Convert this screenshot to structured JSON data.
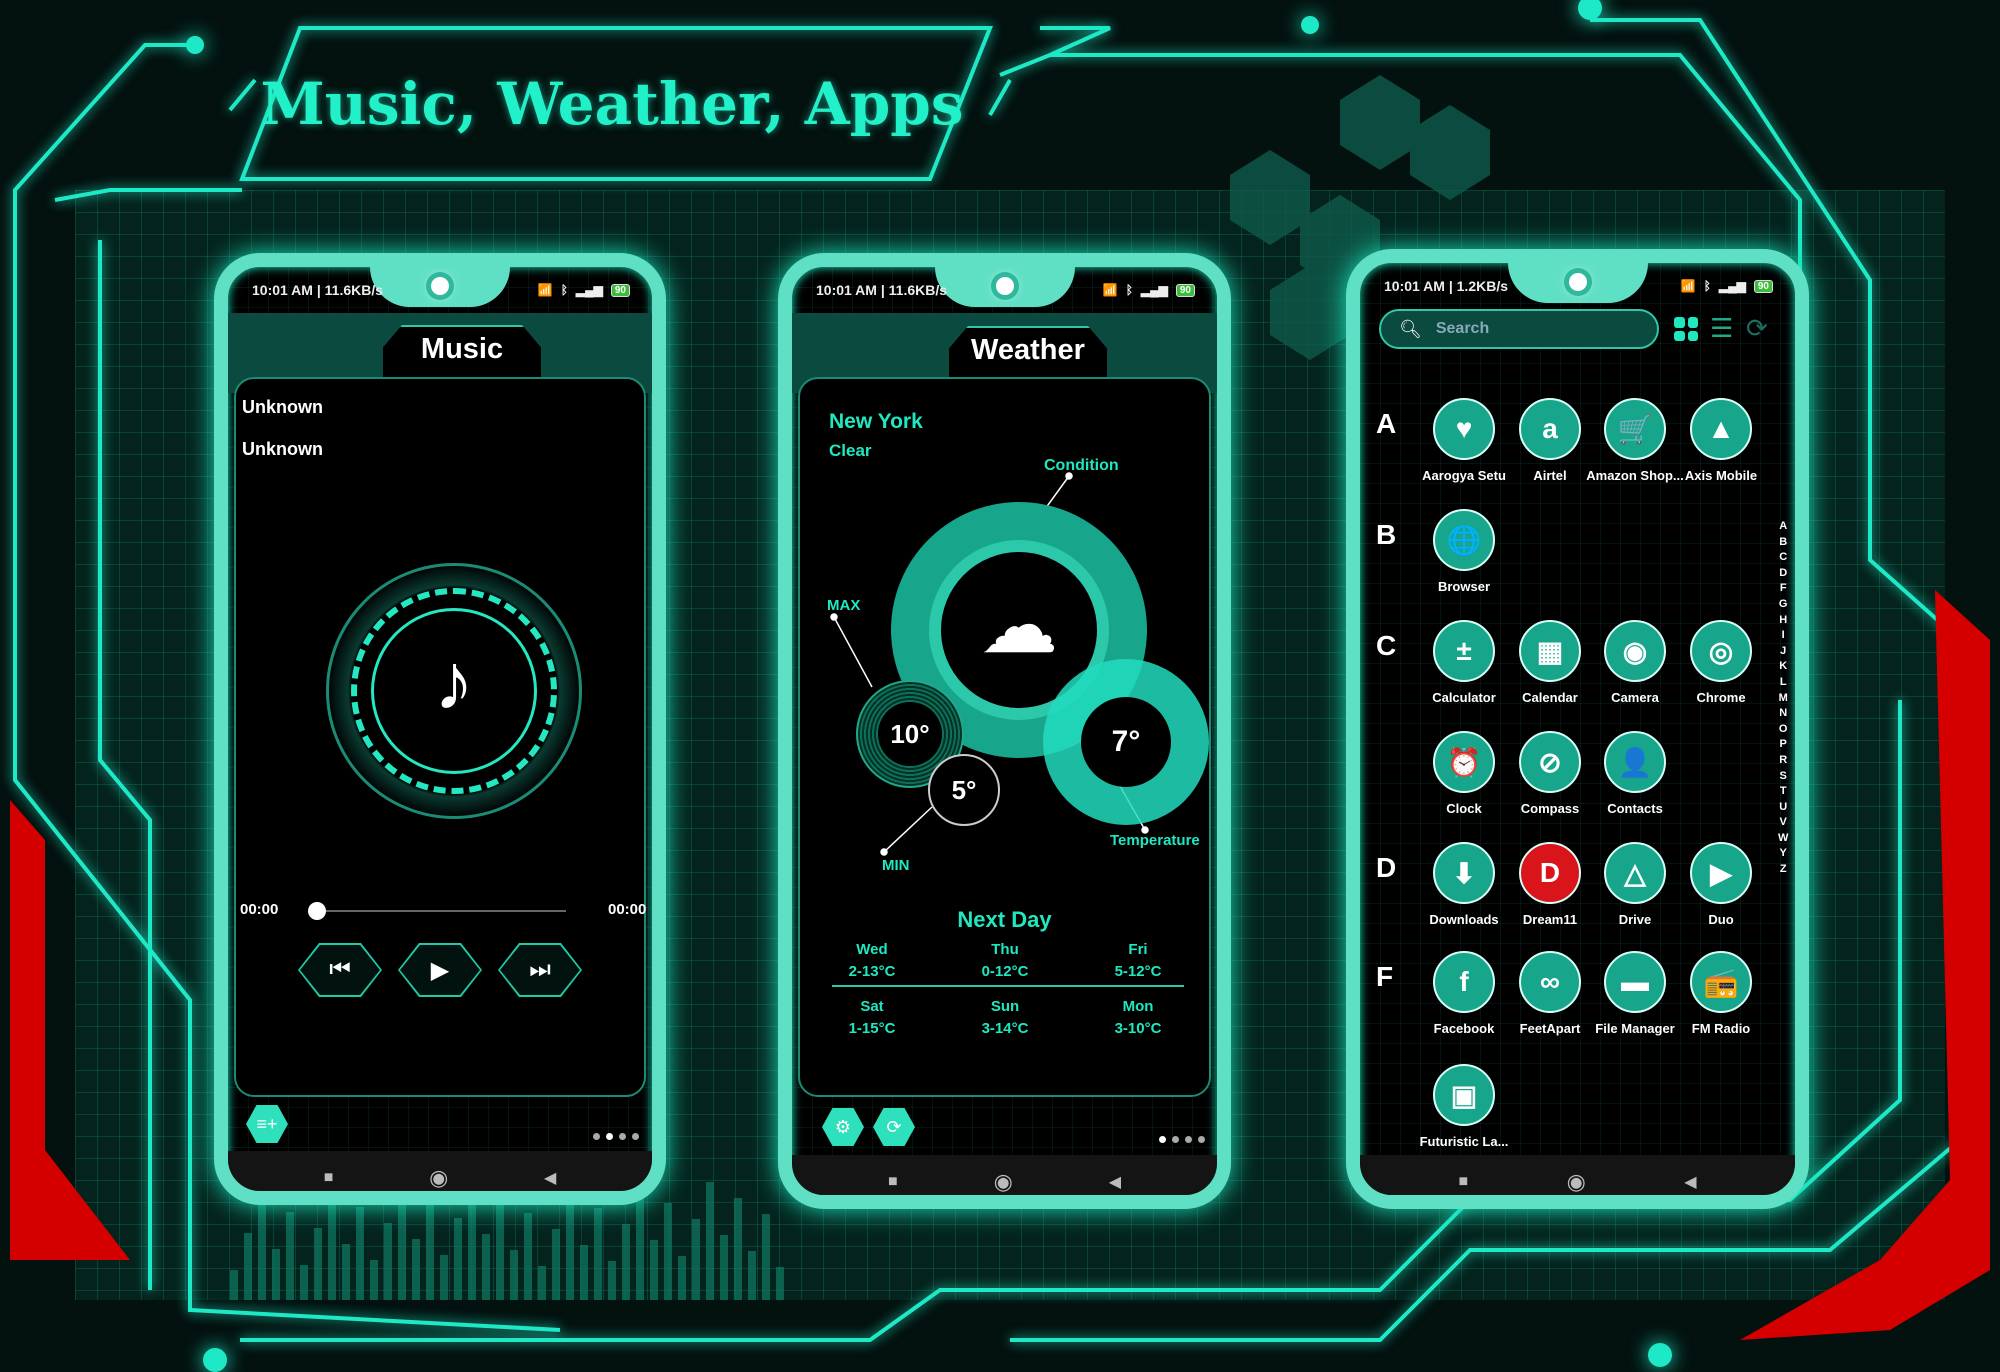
{
  "banner": {
    "title": "Music, Weather, Apps"
  },
  "colors": {
    "accent": "#1de9c6",
    "background": "#03110f",
    "alert": "#d40000",
    "icon_fill": "#17a58b"
  },
  "music_phone": {
    "status": {
      "time": "10:01 AM | 11.6KB/s",
      "battery": "90"
    },
    "header": "Music",
    "track_title": "Unknown",
    "track_artist": "Unknown",
    "elapsed": "00:00",
    "duration": "00:00",
    "progress": 0,
    "controls": {
      "prev": "⏮",
      "play": "▶",
      "next": "⏭"
    },
    "playlist_icon": "playlist-add-icon",
    "page_dots": 4,
    "page_active": 1
  },
  "weather_phone": {
    "status": {
      "time": "10:01 AM | 11.6KB/s",
      "battery": "90"
    },
    "header": "Weather",
    "city": "New York",
    "condition": "Clear",
    "labels": {
      "condition": "Condition",
      "max": "MAX",
      "min": "MIN",
      "temperature": "Temperature"
    },
    "max_temp": "10°",
    "min_temp": "5°",
    "current_temp": "7°",
    "next_day_title": "Next Day",
    "forecast": [
      {
        "day": "Wed",
        "range": "2-13°C"
      },
      {
        "day": "Thu",
        "range": "0-12°C"
      },
      {
        "day": "Fri",
        "range": "5-12°C"
      },
      {
        "day": "Sat",
        "range": "1-15°C"
      },
      {
        "day": "Sun",
        "range": "3-14°C"
      },
      {
        "day": "Mon",
        "range": "3-10°C"
      }
    ],
    "buttons": {
      "settings": "⚙",
      "refresh": "⟳"
    },
    "page_dots": 4,
    "page_active": 0
  },
  "apps_phone": {
    "status": {
      "time": "10:01 AM | 1.2KB/s",
      "battery": "90"
    },
    "search_placeholder": "Search",
    "view_icons": [
      "grid-view-icon",
      "list-view-icon",
      "refresh-icon"
    ],
    "sections": [
      {
        "letter": "A",
        "rows": [
          [
            {
              "name": "Aarogya Setu",
              "glyph": "♥"
            },
            {
              "name": "Airtel",
              "glyph": "a"
            },
            {
              "name": "Amazon Shop...",
              "glyph": "🛒"
            },
            {
              "name": "Axis Mobile",
              "glyph": "▲"
            }
          ]
        ]
      },
      {
        "letter": "B",
        "rows": [
          [
            {
              "name": "Browser",
              "glyph": "🌐"
            }
          ]
        ]
      },
      {
        "letter": "C",
        "rows": [
          [
            {
              "name": "Calculator",
              "glyph": "±"
            },
            {
              "name": "Calendar",
              "glyph": "▦"
            },
            {
              "name": "Camera",
              "glyph": "◉"
            },
            {
              "name": "Chrome",
              "glyph": "◎"
            }
          ],
          [
            {
              "name": "Clock",
              "glyph": "⏰"
            },
            {
              "name": "Compass",
              "glyph": "⊘"
            },
            {
              "name": "Contacts",
              "glyph": "👤"
            }
          ]
        ]
      },
      {
        "letter": "D",
        "rows": [
          [
            {
              "name": "Downloads",
              "glyph": "⬇"
            },
            {
              "name": "Dream11",
              "glyph": "D"
            },
            {
              "name": "Drive",
              "glyph": "△"
            },
            {
              "name": "Duo",
              "glyph": "▶"
            }
          ]
        ]
      },
      {
        "letter": "F",
        "rows": [
          [
            {
              "name": "Facebook",
              "glyph": "f"
            },
            {
              "name": "FeetApart",
              "glyph": "∞"
            },
            {
              "name": "File Manager",
              "glyph": "▬"
            },
            {
              "name": "FM Radio",
              "glyph": "📻"
            }
          ],
          [
            {
              "name": "Futuristic La...",
              "glyph": "▣"
            }
          ]
        ]
      }
    ],
    "alphabet_index": [
      "A",
      "B",
      "C",
      "D",
      "F",
      "G",
      "H",
      "I",
      "J",
      "K",
      "L",
      "M",
      "N",
      "O",
      "P",
      "R",
      "S",
      "T",
      "U",
      "V",
      "W",
      "Y",
      "Z"
    ]
  }
}
